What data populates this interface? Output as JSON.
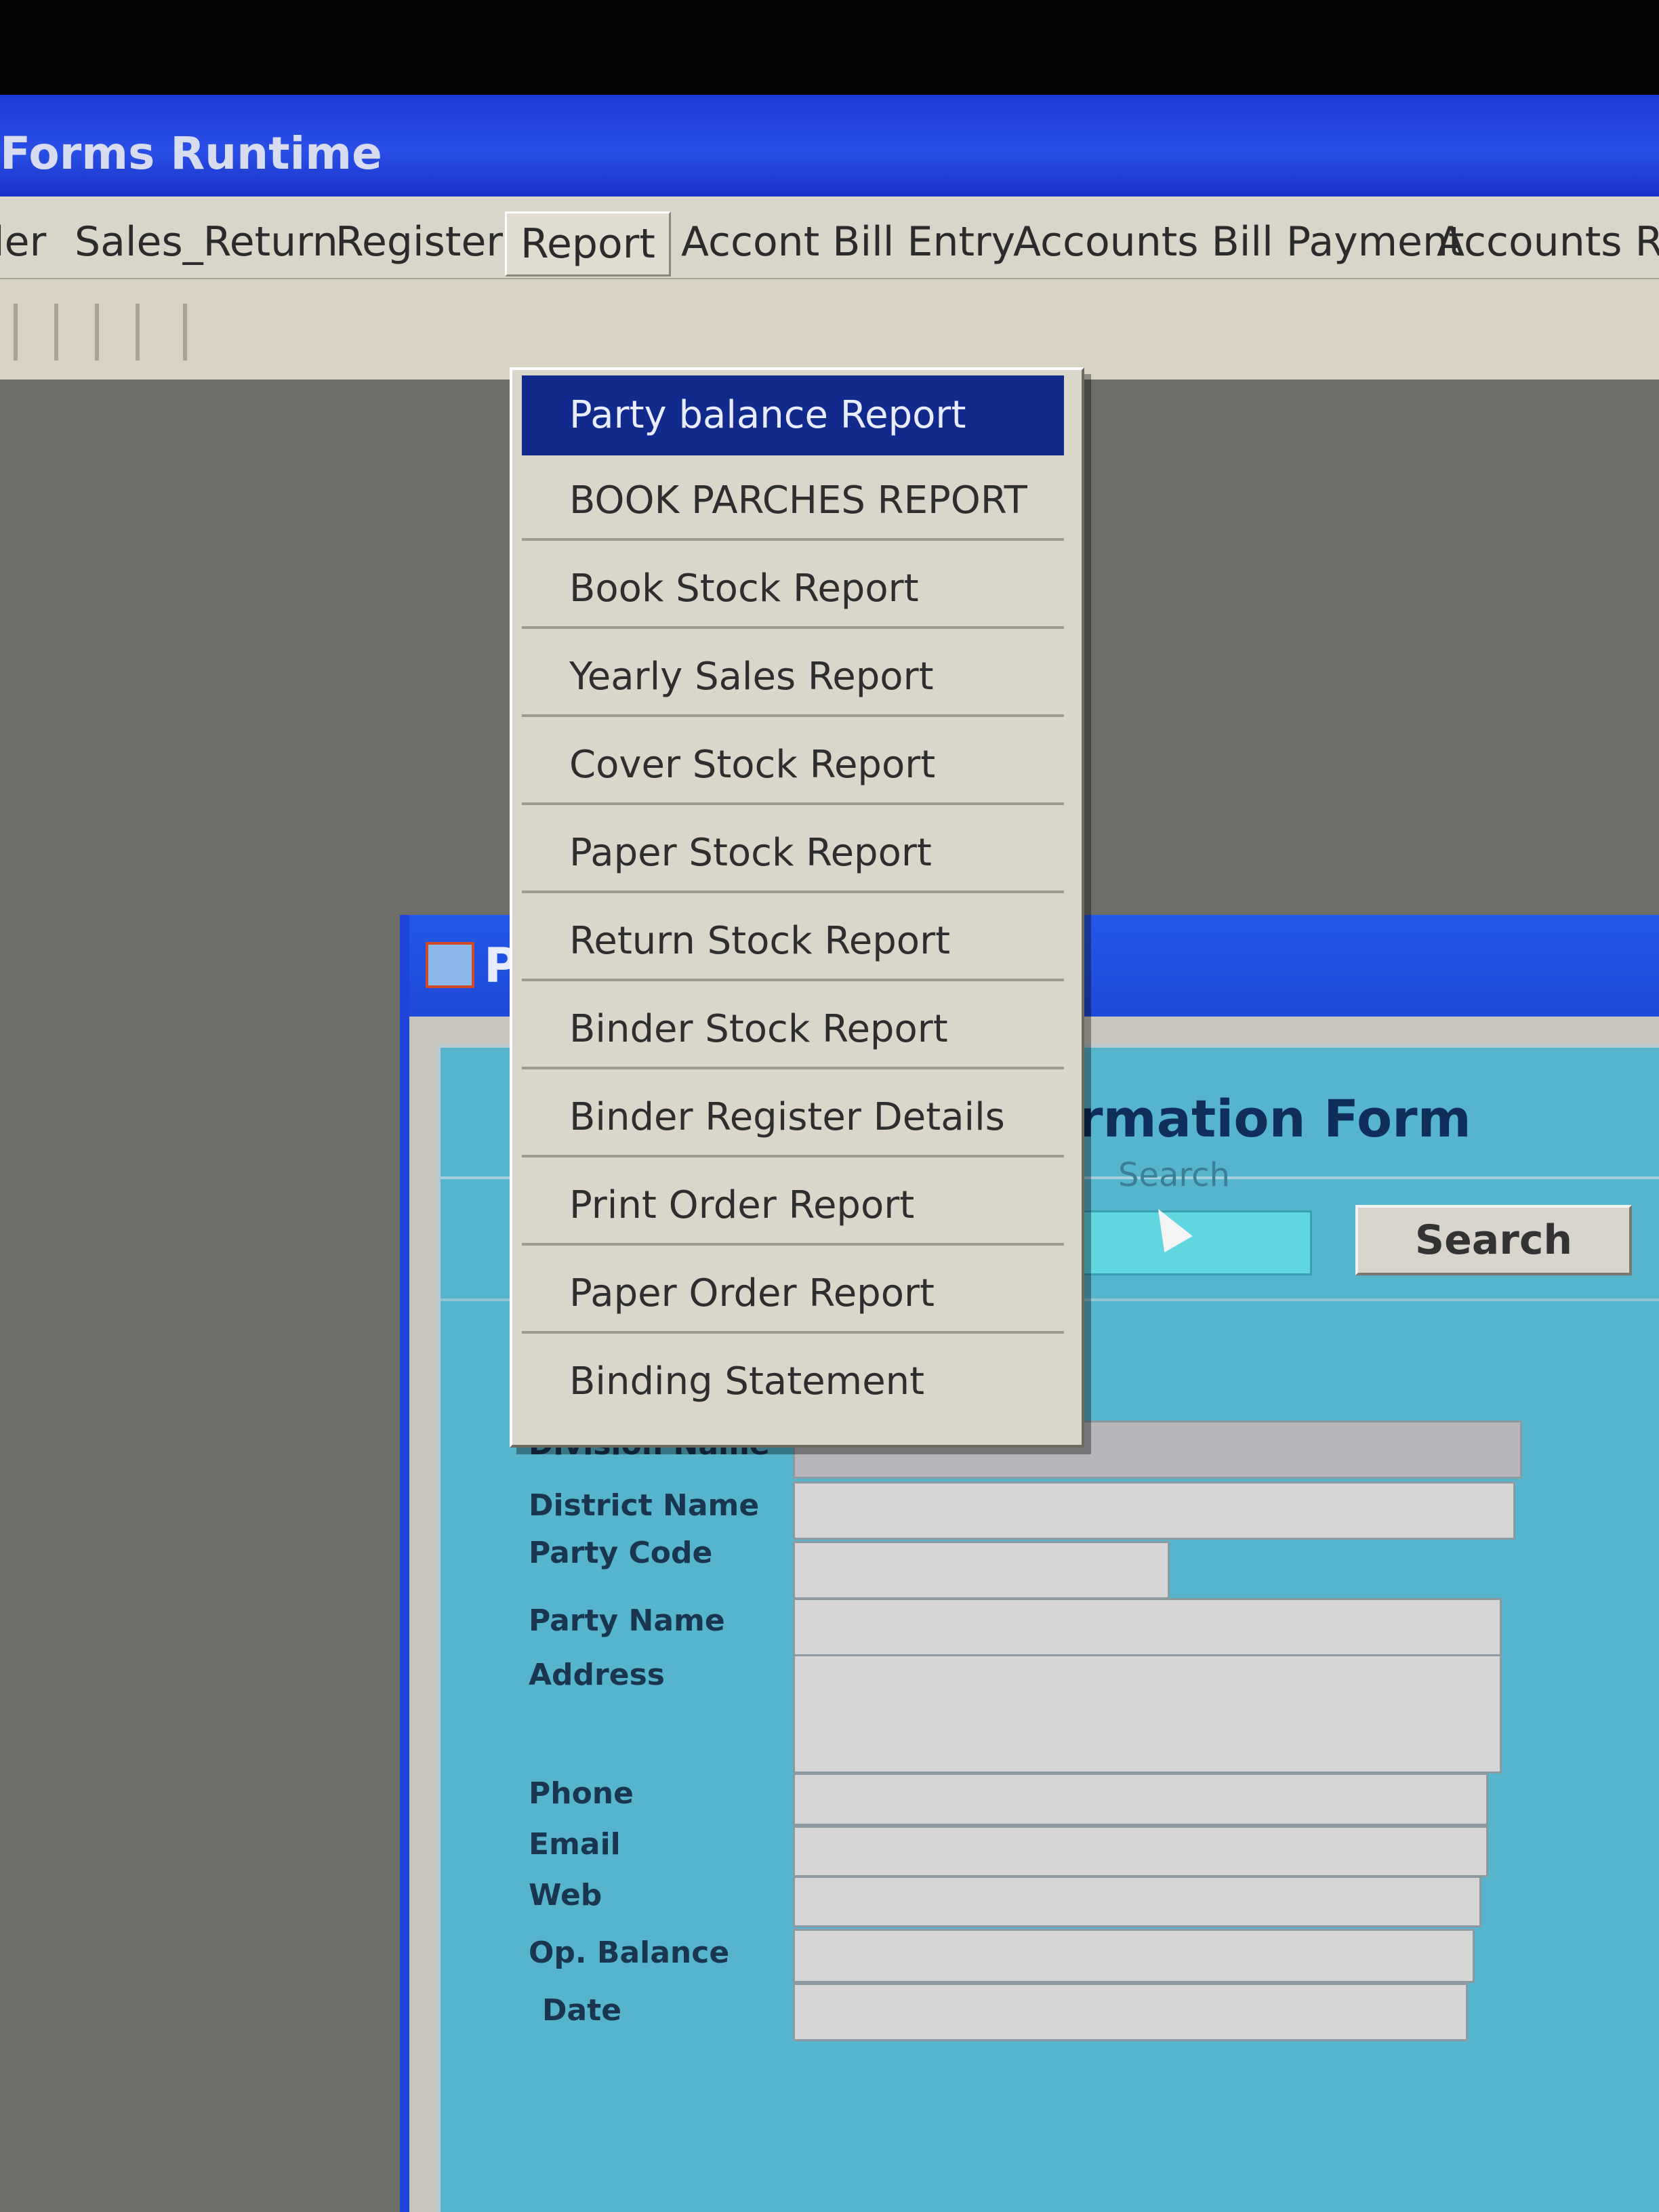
{
  "app": {
    "title": "Forms Runtime"
  },
  "menubar": {
    "items": [
      {
        "label": "ler"
      },
      {
        "label": "Sales_Return"
      },
      {
        "label": "Register"
      },
      {
        "label": "Report"
      },
      {
        "label": "Accont  Bill Entry"
      },
      {
        "label": "Accounts Bill Payment"
      },
      {
        "label": "Accounts Re"
      }
    ]
  },
  "report_menu": {
    "items": [
      {
        "label": "Party balance Report"
      },
      {
        "label": "BOOK PARCHES REPORT"
      },
      {
        "label": "Book Stock Report"
      },
      {
        "label": "Yearly Sales Report"
      },
      {
        "label": "Cover Stock  Report"
      },
      {
        "label": "Paper  Stock  Report"
      },
      {
        "label": "Return Stock Report"
      },
      {
        "label": "Binder Stock Report"
      },
      {
        "label": "Binder Register Details"
      },
      {
        "label": "Print Order Report"
      },
      {
        "label": "Paper Order Report"
      },
      {
        "label": "Binding Statement"
      }
    ],
    "selected_index": 0
  },
  "window": {
    "title": "P",
    "form_heading": "rmation Form",
    "search_legend": "Search",
    "search_button": "Search",
    "search_value": ""
  },
  "form": {
    "labels": {
      "division_name": "Division Name",
      "district_name": "District Name",
      "party_code": "Party Code",
      "party_name": "Party Name",
      "address": "Address",
      "phone": "Phone",
      "email": "Email",
      "web": "Web",
      "op_balance": "Op. Balance",
      "date": "Date"
    }
  },
  "colors": {
    "title_bar": "#1f44d8",
    "menu_selection": "#112a8c",
    "form_background": "#56b4cc",
    "menu_background": "#dad7ca"
  }
}
